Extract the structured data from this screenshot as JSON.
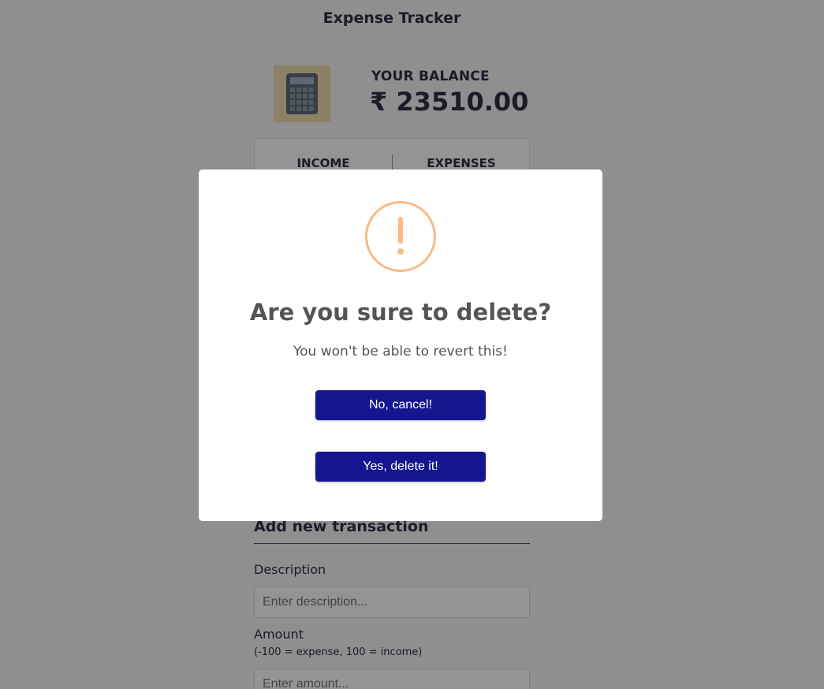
{
  "app": {
    "title": "Expense Tracker"
  },
  "balance": {
    "label": "YOUR BALANCE",
    "value": "₹ 23510.00",
    "logo_icon": "calculator-icon"
  },
  "summary": {
    "income_label": "INCOME",
    "expenses_label": "EXPENSES"
  },
  "form": {
    "title": "Add new transaction",
    "description_label": "Description",
    "description_placeholder": "Enter description...",
    "amount_label": "Amount",
    "amount_hint": "(-100 = expense, 100 = income)",
    "amount_placeholder": "Enter amount..."
  },
  "dialog": {
    "icon": "warning-icon",
    "title": "Are you sure to delete?",
    "text": "You won't be able to revert this!",
    "cancel_label": "No, cancel!",
    "confirm_label": "Yes, delete it!"
  },
  "colors": {
    "button": "#13168e",
    "warning": "#f8bb86",
    "text_dark": "#2e3146",
    "overlay": "rgba(0,0,0,0.42)"
  }
}
